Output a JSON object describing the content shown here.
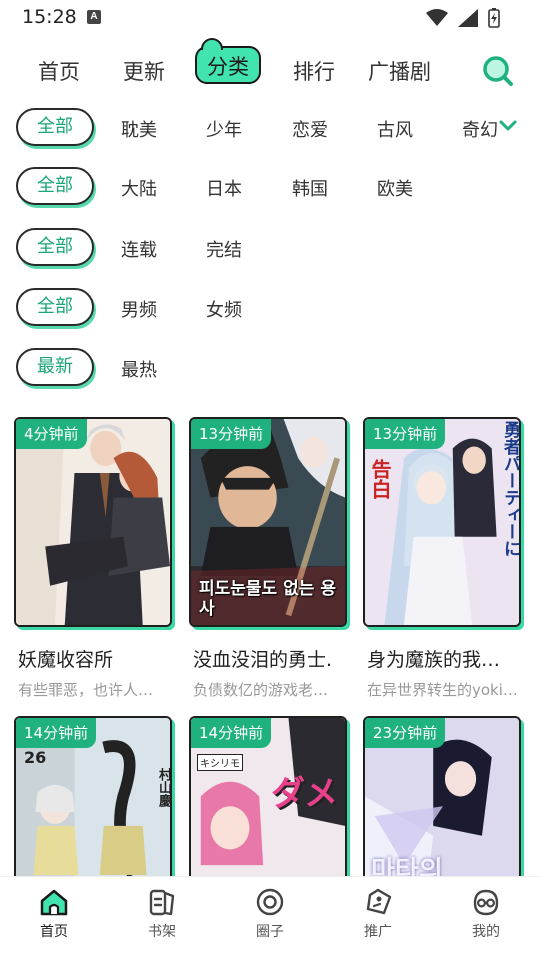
{
  "status_bar": {
    "time": "15:28",
    "notif_glyph": "A"
  },
  "top_nav": {
    "tabs": [
      {
        "label": "首页"
      },
      {
        "label": "更新"
      },
      {
        "label": "分类"
      },
      {
        "label": "排行"
      },
      {
        "label": "广播剧"
      }
    ],
    "active_tab": "分类"
  },
  "filters": {
    "rows": [
      {
        "chip": "全部",
        "options": [
          "耽美",
          "少年",
          "恋爱",
          "古风",
          "奇幻"
        ]
      },
      {
        "chip": "全部",
        "options": [
          "大陆",
          "日本",
          "韩国",
          "欧美"
        ]
      },
      {
        "chip": "全部",
        "options": [
          "连载",
          "完结"
        ]
      },
      {
        "chip": "全部",
        "options": [
          "男频",
          "女频"
        ]
      },
      {
        "chip": "最新",
        "options": [
          "最热"
        ]
      }
    ]
  },
  "comics": [
    {
      "badge": "4分钟前",
      "title": "妖魔收容所",
      "desc": "有些罪恶，也许人…"
    },
    {
      "badge": "13分钟前",
      "title": "没血没泪的勇士.",
      "desc": "负债数亿的游戏老…"
    },
    {
      "badge": "13分钟前",
      "title": "身为魔族的我…",
      "desc": "在异世界转生的yoki…"
    },
    {
      "badge": "14分钟前",
      "title": "",
      "desc": ""
    },
    {
      "badge": "14分钟前",
      "title": "",
      "desc": ""
    },
    {
      "badge": "23分钟前",
      "title": "",
      "desc": ""
    }
  ],
  "cover_text": {
    "c2_kor": "피도눈물도 없는 용사",
    "c3_jp": "勇者パーティーに",
    "c3_jp2": "告白",
    "c4_num": "26",
    "c4_author": "村山慶",
    "c5_jp": "ダメ",
    "c5_author": "キシリモ",
    "c6_kor": "마타의"
  },
  "bottom_tabs": [
    {
      "label": "首页",
      "icon": "home-icon"
    },
    {
      "label": "书架",
      "icon": "bookshelf-icon"
    },
    {
      "label": "圈子",
      "icon": "circle-icon"
    },
    {
      "label": "推广",
      "icon": "promo-icon"
    },
    {
      "label": "我的",
      "icon": "profile-icon"
    }
  ],
  "colors": {
    "accent": "#1fb27f",
    "accent_light": "#41e3ae",
    "chip_text": "#1aa57a"
  }
}
